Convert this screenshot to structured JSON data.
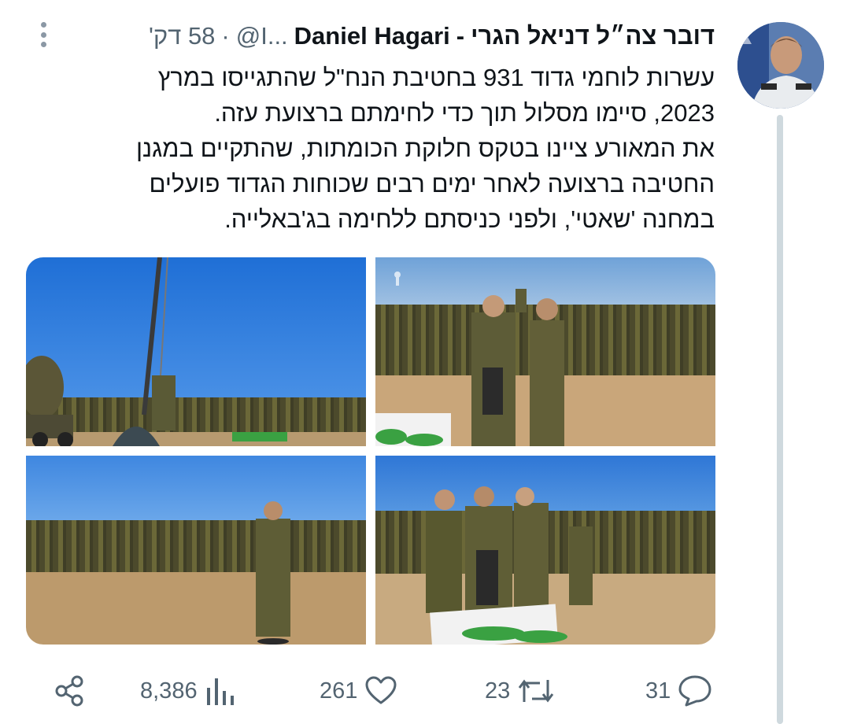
{
  "tweet": {
    "author_name_he": "דובר צה״ל דניאל הגרי",
    "author_name_separator": "-",
    "author_name_en": "Daniel Hagari",
    "handle": "@I...",
    "separator": "·",
    "time": "58 דק'",
    "paragraphs": [
      "עשרות לוחמי גדוד 931 בחטיבת הנח\"ל שהתגייסו במרץ 2023, סיימו מסלול תוך כדי לחימתם ברצועת עזה.",
      "את המאורע ציינו בטקס חלוקת הכומתות, שהתקיים במגנן החטיבה ברצועה לאחר ימים רבים שכוחות הגדוד פועלים במחנה 'שאטי', ולפני כניסתם ללחימה בג'באלייה."
    ],
    "photos": [
      "ceremony-flagpole",
      "beret-ceremony",
      "battalion-formation",
      "beret-placing"
    ]
  },
  "actions": {
    "replies": "31",
    "retweets": "23",
    "likes": "261",
    "views": "8,386"
  },
  "icons": {
    "share": "share-icon",
    "views": "bar-chart-icon",
    "like": "heart-icon",
    "retweet": "retweet-icon",
    "reply": "reply-icon",
    "more": "more-vertical-icon"
  },
  "colors": {
    "text": "#0f1419",
    "muted": "#536471",
    "thread_line": "#cfd9de"
  }
}
